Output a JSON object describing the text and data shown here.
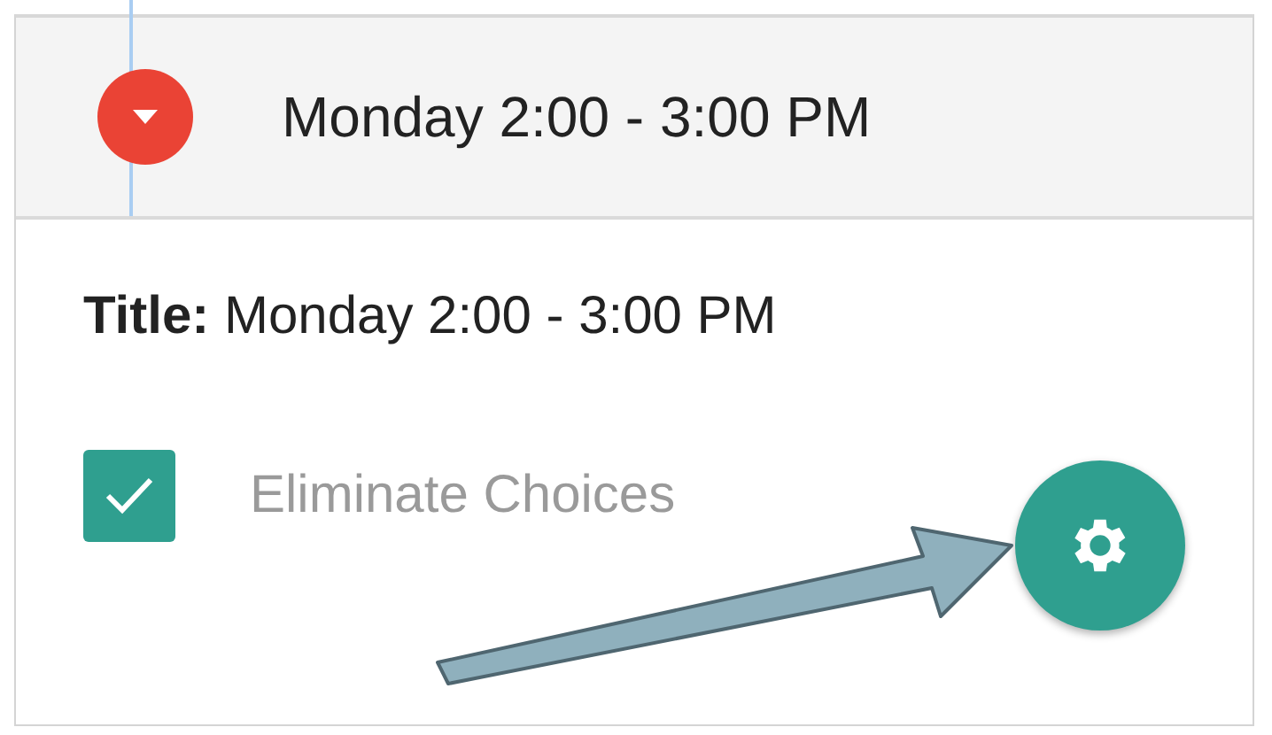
{
  "header": {
    "title": "Monday 2:00 - 3:00 PM"
  },
  "details": {
    "title_line": "**Title:** Monday 2:00 - 3:00 PM"
  },
  "option": {
    "label": "Eliminate Choices",
    "checked": true
  }
}
